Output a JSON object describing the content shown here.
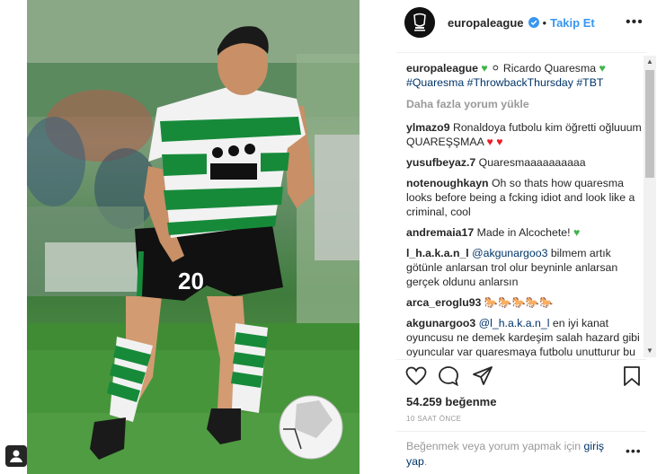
{
  "header": {
    "username": "europaleague",
    "separator": "•",
    "follow_label": "Takip Et",
    "more_label": "•••"
  },
  "caption": {
    "username": "europaleague",
    "text_line1": "⚪ Ricardo Quaresma",
    "hashtags": [
      "#Quaresma",
      "#ThrowbackThursday",
      "#TBT"
    ]
  },
  "load_more_label": "Daha fazla yorum yükle",
  "comments": [
    {
      "username": "ylmazo9",
      "text": "Ronaldoya futbolu kim öğretti oğluuum QUAREŞŞMAA"
    },
    {
      "username": "yusufbeyaz.7",
      "text": "Quaresmaaaaaaaaaa"
    },
    {
      "username": "notenoughkayn",
      "text": "Oh so thats how quaresma looks before being a fcking idiot and look like a criminal, cool"
    },
    {
      "username": "andremaia17",
      "text": "Made in Alcochete!"
    },
    {
      "username": "l_h.a.k.a.n_l",
      "mention": "@akgunargoo3",
      "text": "bilmem artık götünle anlarsan trol olur beyninle anlarsan gerçek oldunu anlarsın"
    },
    {
      "username": "arca_eroglu93",
      "text": ""
    },
    {
      "username": "akgunargoo3",
      "mention": "@l_h.a.k.a.n_l",
      "text": "en iyi kanat oyuncusu ne demek kardeşim salah hazard gibi oyuncular var quaresmaya futbolu unutturur bu adamlar"
    }
  ],
  "likes_text": "54.259 beğenme",
  "time_ago": "10 SAAT ÖNCE",
  "login_prompt": {
    "text": "Beğenmek veya yorum yapmak için",
    "link": "giriş yap",
    "period": "."
  },
  "colors": {
    "link_blue": "#3897f0",
    "hashtag": "#003569",
    "muted": "#999999",
    "green_heart": "#3fb34a",
    "red_heart": "#ed1c24"
  }
}
